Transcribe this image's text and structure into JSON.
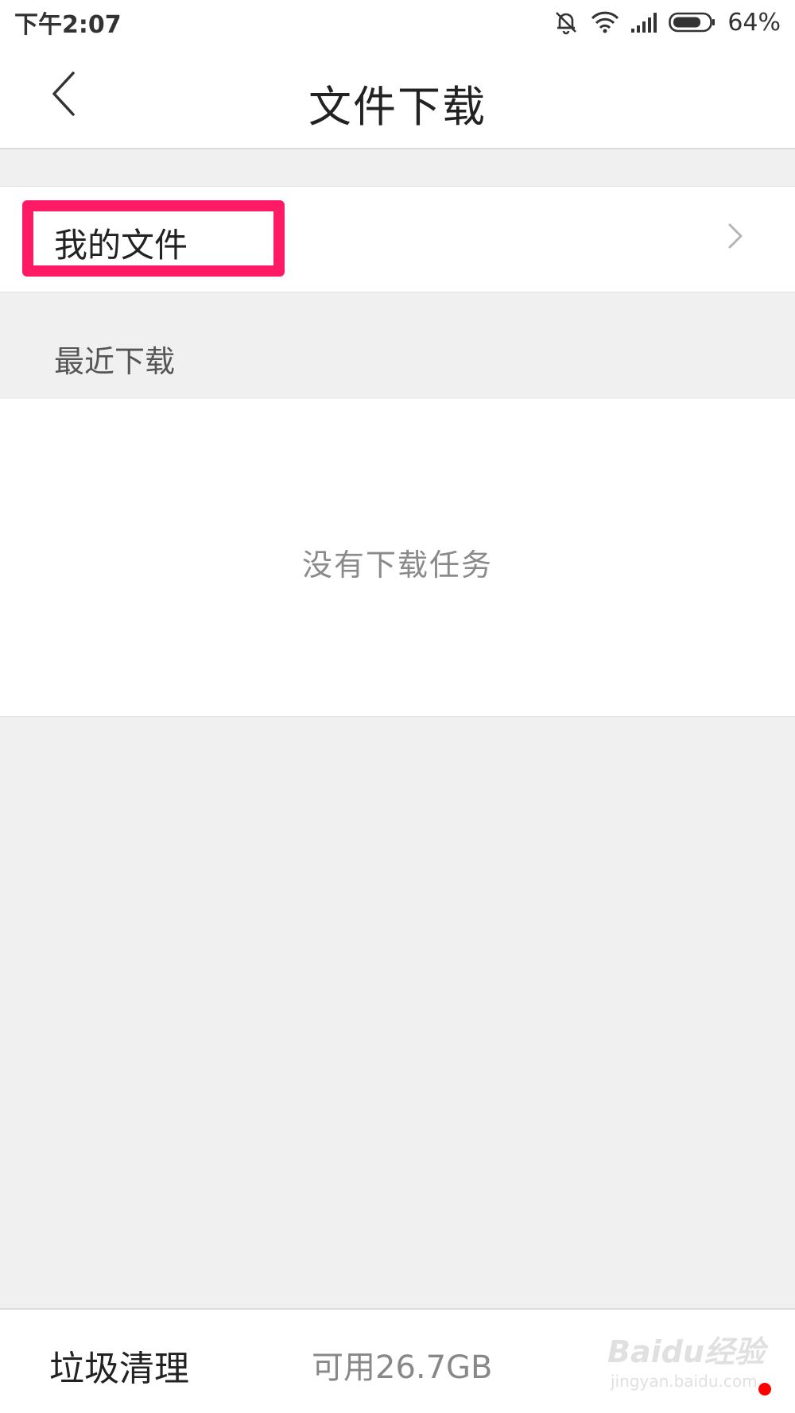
{
  "status_bar": {
    "time": "下午2:07",
    "battery": "64%",
    "icons": [
      "mute-bell-icon",
      "wifi-icon",
      "signal-icon",
      "battery-icon"
    ]
  },
  "header": {
    "title": "文件下载",
    "back_icon": "chevron-left-icon"
  },
  "my_files": {
    "label": "我的文件",
    "chevron_icon": "chevron-right-icon",
    "highlight_color": "#ff1a66"
  },
  "recent": {
    "section_label": "最近下载",
    "empty_text": "没有下载任务"
  },
  "bottom_bar": {
    "cleanup_label": "垃圾清理",
    "storage_text": "可用26.7GB",
    "watermark_main": "Baidu经验",
    "watermark_sub": "jingyan.baidu.com"
  },
  "colors": {
    "background": "#f0f0f0",
    "panel": "#ffffff",
    "notification_dot": "#ff0000"
  }
}
